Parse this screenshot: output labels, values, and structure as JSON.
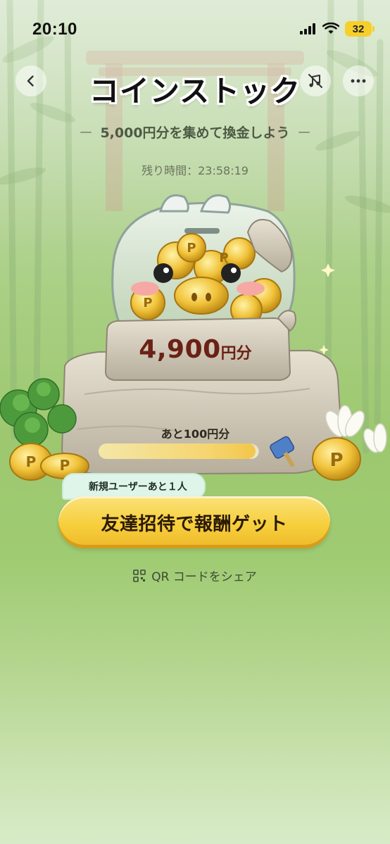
{
  "status_bar": {
    "time": "20:10",
    "battery": "32"
  },
  "header": {
    "title": "コインストック",
    "subtitle": "5,000円分を集めて換金しよう",
    "timer_label": "残り時間：",
    "timer_value": "23:58:19"
  },
  "hero": {
    "amount_value": "4,900",
    "amount_unit": "円分",
    "remaining_label": "あと100円分",
    "progress": 0.98
  },
  "cta": {
    "badge_text": "新規ユーザーあと１人",
    "button_label": "友達招待で報酬ゲット",
    "qr_label": "QR コードをシェア"
  },
  "colors": {
    "accent": "#f6cf3c",
    "amount_text": "#6b2115",
    "battery": "#f6cf2b"
  },
  "icons": {
    "back": "chevron-left-icon",
    "music": "music-off-icon",
    "more": "more-dots-icon",
    "qr": "qr-code-icon"
  }
}
